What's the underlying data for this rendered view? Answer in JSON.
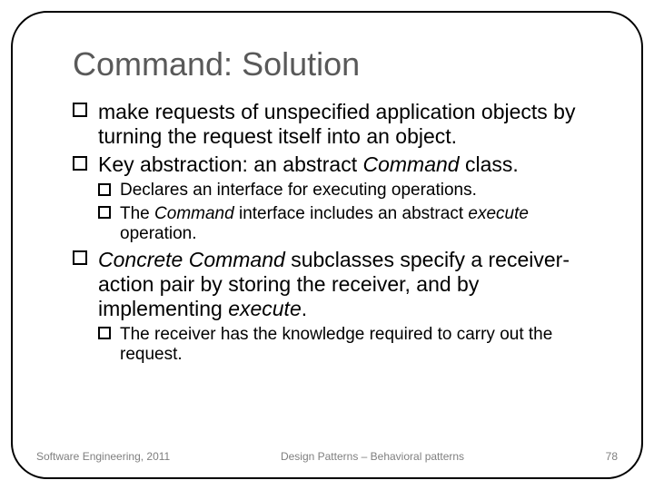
{
  "title": "Command: Solution",
  "bullets": {
    "b1": {
      "pre": "make requests of unspecified application objects by turning the request itself into an object."
    },
    "b2": {
      "pre": "Key abstraction: an abstract ",
      "em": "Command",
      "post": " class."
    },
    "b2a": {
      "pre": "Declares an interface for executing operations."
    },
    "b2b": {
      "pre": "The ",
      "em1": "Command",
      "mid": " interface includes an abstract ",
      "em2": "execute",
      "post": " operation."
    },
    "b3": {
      "em1": "Concrete Command",
      "mid": " subclasses specify a receiver-action pair by storing the receiver, and by implementing ",
      "em2": "execute",
      "post": "."
    },
    "b3a": {
      "pre": "The receiver has the knowledge required to carry out the request."
    }
  },
  "footer": {
    "left": "Software Engineering, 2011",
    "center": "Design Patterns – Behavioral patterns",
    "right": "78"
  }
}
